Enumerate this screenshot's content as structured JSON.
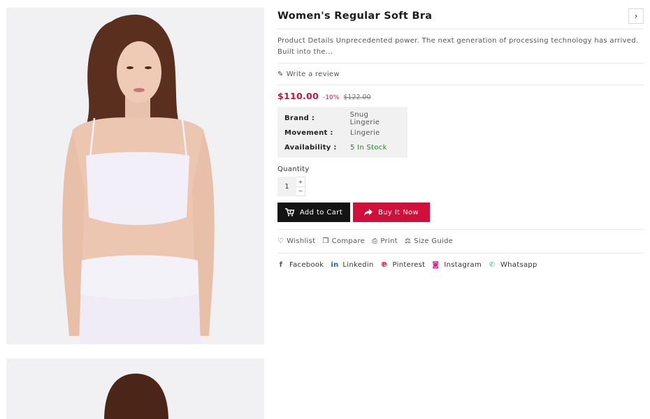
{
  "product": {
    "title": "Women's Regular Soft Bra",
    "next_icon": "chevron-right-icon",
    "description": "Product Details Unprecedented power. The next generation of processing technology has arrived. Built into the...",
    "review_label": "Write a review",
    "price": "$110.00",
    "discount": "-10%",
    "old_price": "$122.00"
  },
  "specs": [
    {
      "label": "Brand :",
      "value": "Snug Lingerie"
    },
    {
      "label": "Movement :",
      "value": "Lingerie"
    },
    {
      "label": "Availability :",
      "value": "5 In Stock"
    }
  ],
  "quantity": {
    "label": "Quantity",
    "value": "1",
    "plus": "+",
    "minus": "−"
  },
  "buttons": {
    "add_to_cart": "Add to Cart",
    "buy_now": "Buy It Now"
  },
  "tools": {
    "wishlist": "Wishlist",
    "compare": "Compare",
    "print": "Print",
    "size_guide": "Size Guide"
  },
  "share": {
    "facebook": "Facebook",
    "linkedin": "Linkedin",
    "pinterest": "Pinterest",
    "instagram": "Instagram",
    "whatsapp": "Whatsapp"
  },
  "colors": {
    "accent": "#d0103a",
    "stock": "#1e8a1e",
    "cart_button": "#141414",
    "facebook": "#3b5998",
    "linkedin": "#0a66c2",
    "pinterest": "#e60023",
    "instagram": "#d6249f",
    "whatsapp": "#25d366"
  }
}
